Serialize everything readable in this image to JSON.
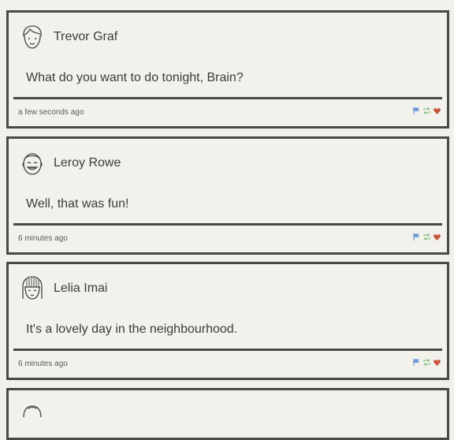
{
  "comments": [
    {
      "author": "Trevor Graf",
      "avatar_icon": "boy-face-avatar-icon",
      "text": "What do you want to do tonight, Brain?",
      "time": "a few seconds ago"
    },
    {
      "author": "Leroy Rowe",
      "avatar_icon": "smiling-face-avatar-icon",
      "text": "Well, that was fun!",
      "time": "6 minutes ago"
    },
    {
      "author": "Lelia Imai",
      "avatar_icon": "girl-bangs-avatar-icon",
      "text": "It's a lovely day in the neighbourhood.",
      "time": "6 minutes ago"
    }
  ],
  "action_icons": [
    "flag-icon",
    "retweet-icon",
    "heart-icon"
  ],
  "colors": {
    "page_bg": "#f2f0eb",
    "card_border": "#4a4946",
    "flag": "#6e9ad6",
    "retweet": "#7cc07a",
    "heart": "#c8543b"
  }
}
